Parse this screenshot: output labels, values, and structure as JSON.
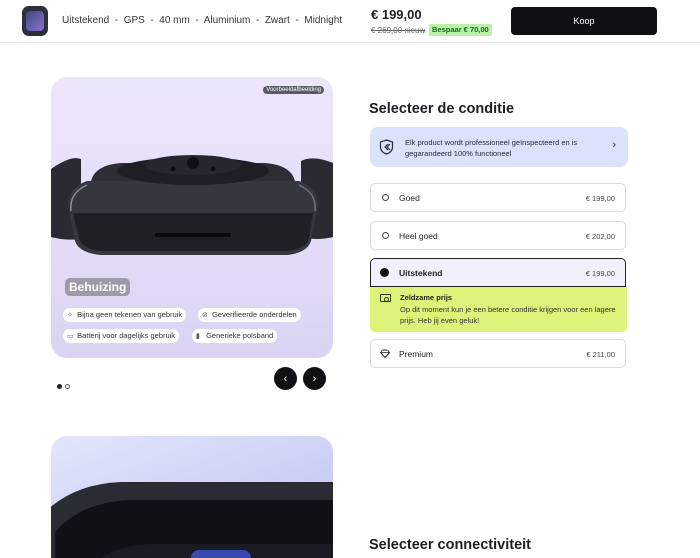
{
  "topbar": {
    "product_title": "Uitstekend  -  GPS  -  40 mm  -  Aluminium  -  Zwart  -  Midnight",
    "price_now": "€ 199,00",
    "price_old": "€ 269,00 nieuw",
    "save_badge": "Bespaar € 70,00",
    "buy_label": "Koop"
  },
  "gallery": {
    "example_badge": "Voorbeeldafbeelding",
    "caption": "Behuizing",
    "chips": [
      {
        "icon": "sparkle-icon",
        "label": "Bijna geen tekenen van gebruik"
      },
      {
        "icon": "check-circle-icon",
        "label": "Geverifieerde onderdelen"
      },
      {
        "icon": "battery-icon",
        "label": "Batterij voor dagelijks gebruik"
      },
      {
        "icon": "watch-band-icon",
        "label": "Generieke polsband"
      }
    ],
    "prev_glyph": "‹",
    "next_glyph": "›"
  },
  "condition": {
    "title": "Selecteer de conditie",
    "info_text": "Elk product wordt professioneel geïnspecteerd en is gegarandeerd 100% functioneel",
    "options": [
      {
        "label": "Goed",
        "price": "€ 199,00"
      },
      {
        "label": "Heel goed",
        "price": "€ 202,00"
      },
      {
        "label": "Uitstekend",
        "price": "€ 199,00"
      }
    ],
    "rare": {
      "title": "Zeldzame prijs",
      "text": "Op dit moment kun je een betere conditie krijgen voor een lagere prijs. Heb jij even geluk!"
    },
    "premium": {
      "label": "Premium",
      "price": "€ 211,00"
    }
  },
  "connectivity": {
    "title": "Selecteer connectiviteit"
  },
  "colors": {
    "accent_dark": "#111115",
    "save_green": "#b9f2a7",
    "rare_yellow": "#dcf37a",
    "info_blue": "#dbe2fb"
  }
}
